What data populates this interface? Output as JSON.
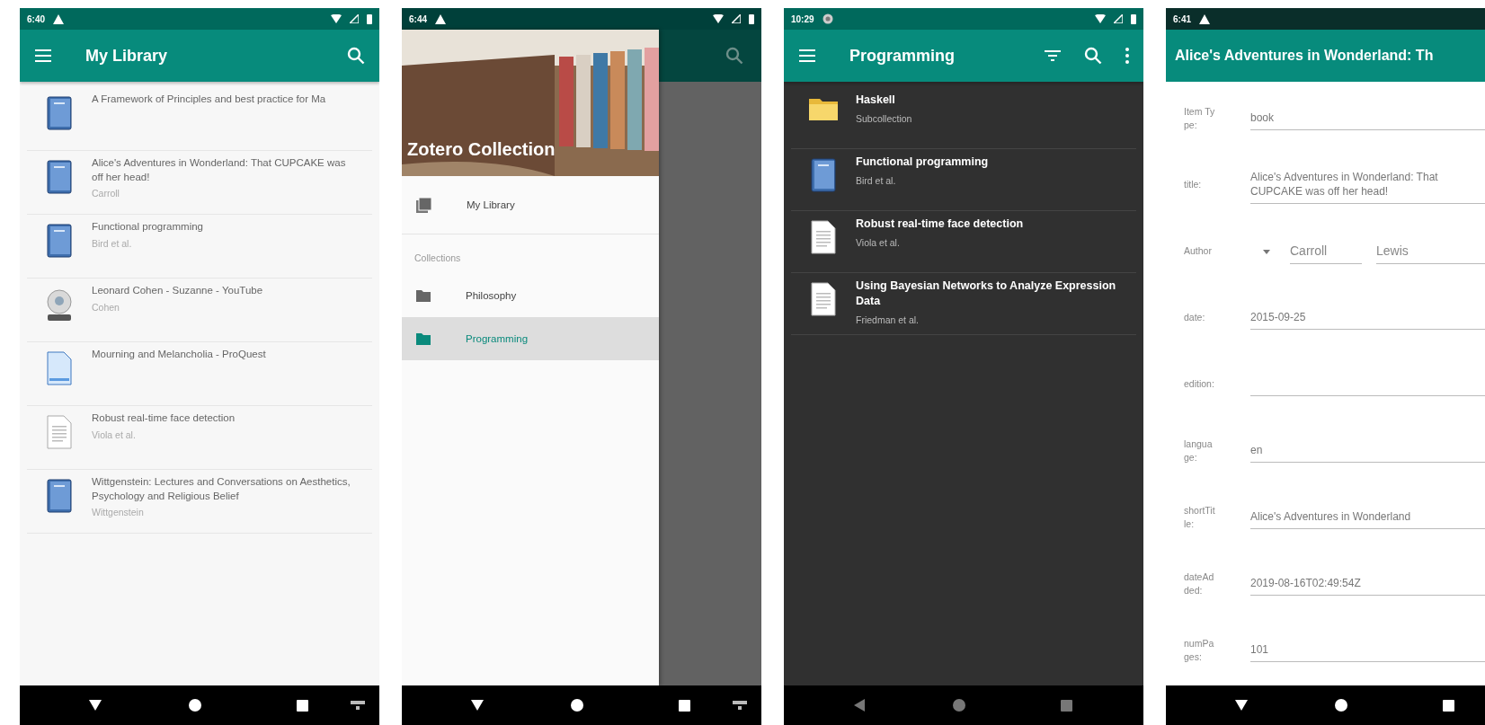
{
  "screens": [
    {
      "kind": "list",
      "dark": false,
      "status_bar": {
        "time": "6:40",
        "notification": {
          "kind": "warning"
        },
        "system_icons": true
      },
      "app_bar": {
        "nav_button": {
          "kind": "menu"
        },
        "title": "My Library",
        "actions": [
          {
            "kind": "search"
          }
        ]
      },
      "items": [
        {
          "kind": "book",
          "title": "A Framework of Principles and best practice for Ma"
        },
        {
          "kind": "book",
          "title": "Alice's Adventures in Wonderland: That CUPCAKE was off her head!",
          "subtitle": "Carroll"
        },
        {
          "kind": "book",
          "title": "Functional programming",
          "subtitle": "Bird et al."
        },
        {
          "kind": "video",
          "title": "Leonard Cohen - Suzanne - YouTube",
          "subtitle": "Cohen"
        },
        {
          "kind": "webpage",
          "title": "Mourning and Melancholia - ProQuest"
        },
        {
          "kind": "document",
          "title": "Robust real-time face detection",
          "subtitle": "Viola et al."
        },
        {
          "kind": "book",
          "title": "Wittgenstein: Lectures and Conversations on Aesthetics, Psychology and Religious Belief",
          "subtitle": "Wittgenstein"
        }
      ],
      "nav_bar": {
        "back_button": {
          "kind": "down"
        },
        "keyboard_switch": true,
        "dimmed": false
      }
    },
    {
      "kind": "drawer",
      "status_bar": {
        "time": "6:44",
        "notification": {
          "kind": "warning"
        },
        "system_icons": true
      },
      "header": {
        "title": "Zotero Collection"
      },
      "library_item": {
        "label": "My Library",
        "selected": false
      },
      "section_header": "Collections",
      "collections": [
        {
          "label": "Philosophy",
          "selected": false
        },
        {
          "label": "Programming",
          "selected": true
        }
      ],
      "behind": {
        "actions": [
          {
            "kind": "search"
          }
        ]
      },
      "nav_bar": {
        "back_button": {
          "kind": "down"
        },
        "keyboard_switch": true,
        "dimmed": false
      }
    },
    {
      "kind": "list",
      "dark": true,
      "status_bar": {
        "time": "10:29",
        "notification": {
          "kind": "sync"
        },
        "system_icons": true
      },
      "app_bar": {
        "nav_button": {
          "kind": "menu"
        },
        "title": "Programming",
        "actions": [
          {
            "kind": "filter"
          },
          {
            "kind": "search"
          },
          {
            "kind": "more"
          }
        ]
      },
      "items": [
        {
          "kind": "folder",
          "title": "Haskell",
          "subtitle": "Subcollection"
        },
        {
          "kind": "book",
          "title": "Functional programming",
          "subtitle": "Bird et al."
        },
        {
          "kind": "document",
          "title": "Robust real-time face detection",
          "subtitle": "Viola et al."
        },
        {
          "kind": "document",
          "title": "Using Bayesian Networks to Analyze Expression Data",
          "subtitle": "Friedman et al."
        }
      ],
      "nav_bar": {
        "back_button": {
          "kind": "left"
        },
        "keyboard_switch": false,
        "dimmed": true
      }
    },
    {
      "kind": "detail",
      "status_bar": {
        "time": "6:41",
        "notification": {
          "kind": "warning"
        },
        "system_icons": false
      },
      "title_bar": {
        "title": "Alice's Adventures in Wonderland: Th"
      },
      "fields": [
        {
          "kind": "text",
          "label": "Item Type:",
          "value": "book"
        },
        {
          "kind": "text",
          "label": "title:",
          "value": "Alice's Adventures in Wonderland: That CUPCAKE was off her head!"
        },
        {
          "kind": "creator",
          "label": "Author",
          "last_name": "Carroll",
          "first_name": "Lewis"
        },
        {
          "kind": "text",
          "label": "date:",
          "value": "2015-09-25"
        },
        {
          "kind": "text",
          "label": "edition:"
        },
        {
          "kind": "text",
          "label": "language:",
          "value": "en"
        },
        {
          "kind": "text",
          "label": "shortTitle:",
          "value": "Alice's Adventures in Wonderland"
        },
        {
          "kind": "text",
          "label": "dateAdded:",
          "value": "2019-08-16T02:49:54Z"
        },
        {
          "kind": "text",
          "label": "numPages:",
          "value": "101"
        }
      ],
      "nav_bar": {
        "back_button": {
          "kind": "down"
        },
        "dimmed": false
      }
    }
  ]
}
